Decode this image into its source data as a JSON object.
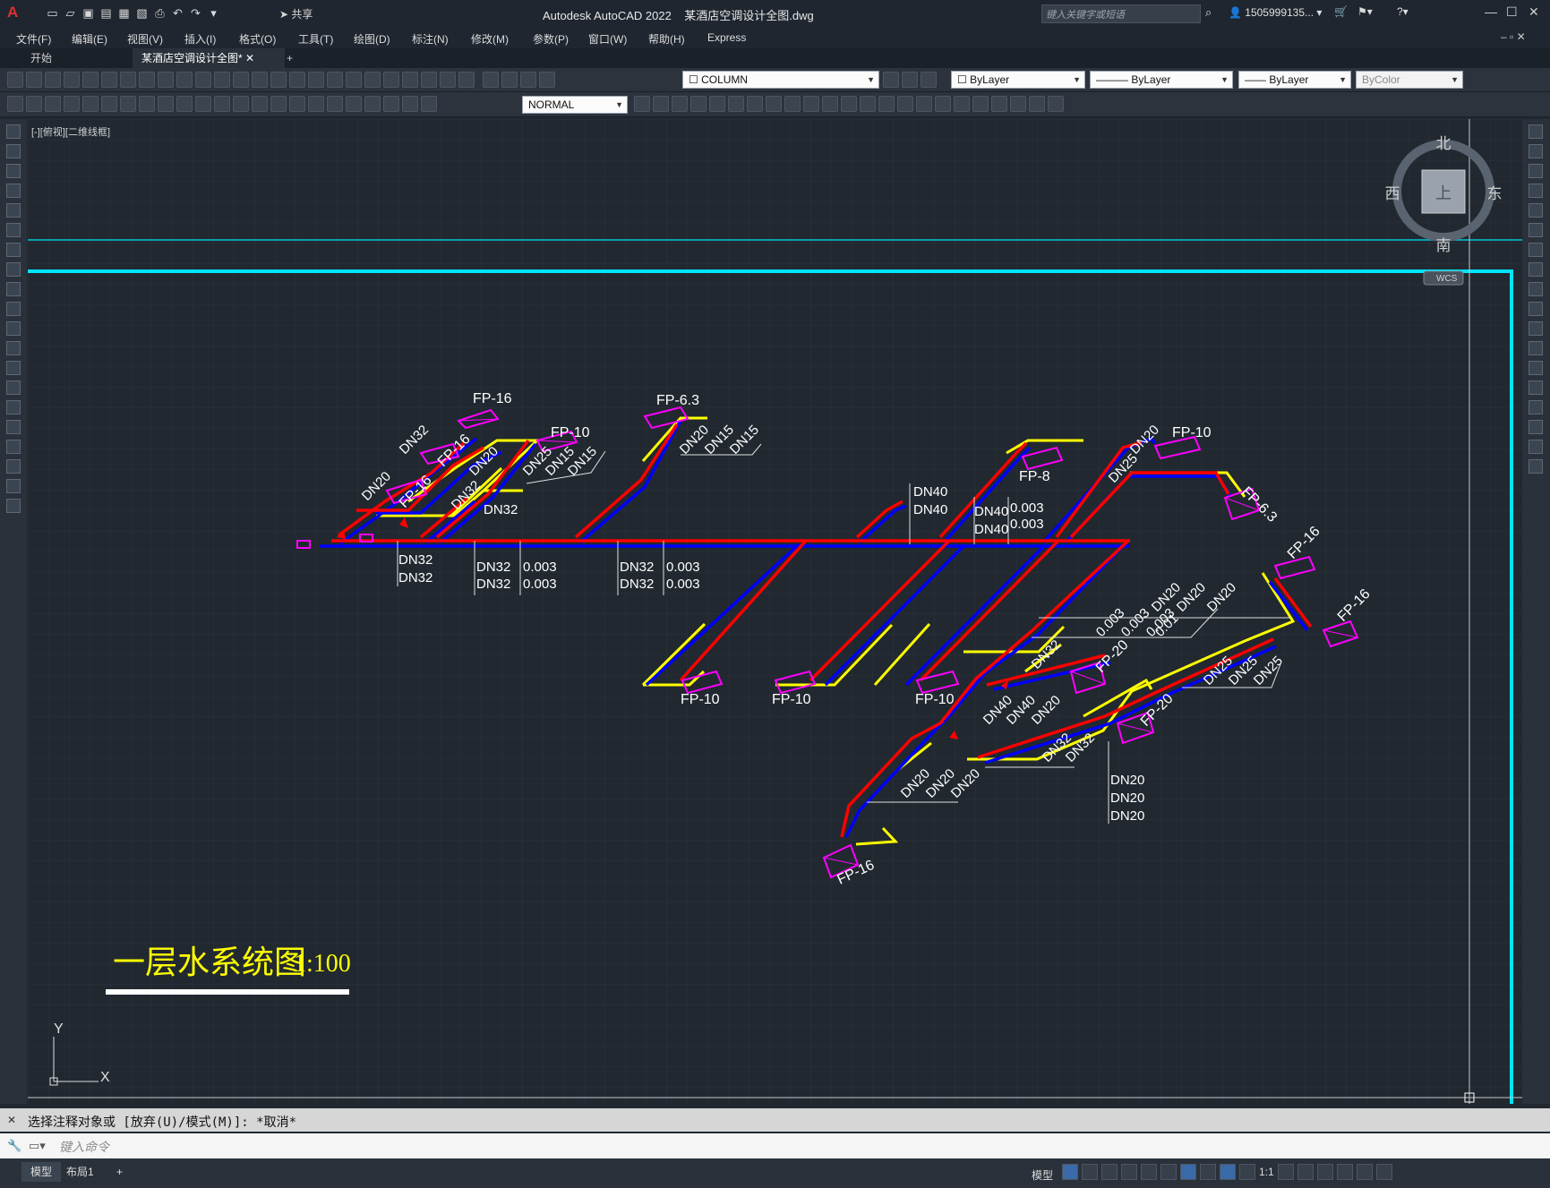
{
  "app": {
    "logo": "A",
    "title": "Autodesk AutoCAD 2022",
    "document": "某酒店空调设计全图.dwg",
    "share_label": "共享",
    "search_placeholder": "键入关键字或短语",
    "user": "1505999135..."
  },
  "menu": [
    "文件(F)",
    "编辑(E)",
    "视图(V)",
    "插入(I)",
    "格式(O)",
    "工具(T)",
    "绘图(D)",
    "标注(N)",
    "修改(M)",
    "参数(P)",
    "窗口(W)",
    "帮助(H)",
    "Express"
  ],
  "tabs": {
    "start": "开始",
    "active": "某酒店空调设计全图*",
    "close": "✕",
    "new": "+"
  },
  "toolbar": {
    "layer": "COLUMN",
    "color": "ByLayer",
    "linetype": "ByLayer",
    "lineweight": "ByLayer",
    "plotstyle": "ByColor",
    "dimstyle": "NORMAL"
  },
  "viewport": {
    "label": "[-][俯视][二维线框]"
  },
  "viewcube": {
    "north": "北",
    "south": "南",
    "east": "东",
    "west": "西",
    "top": "上",
    "wcs": "WCS"
  },
  "drawing": {
    "title": "一层水系统图",
    "scale": "1:100",
    "units": [
      "FP-16",
      "FP-10",
      "FP-6.3",
      "FP-16",
      "FP-16",
      "FP-8",
      "FP-10",
      "FP-6.3",
      "FP-16",
      "FP-16",
      "FP-20",
      "FP-20",
      "FP-10",
      "FP-10",
      "FP-10",
      "FP-16"
    ],
    "pipe_labels": [
      "DN32",
      "DN20",
      "DN32",
      "DN20",
      "DN25",
      "DN15",
      "DN15",
      "DN32",
      "DN20",
      "DN15",
      "DN15",
      "DN32",
      "DN32",
      "DN32",
      "DN32",
      "DN32",
      "DN32",
      "DN40",
      "DN40",
      "DN40",
      "DN40",
      "DN25",
      "DN20",
      "DN32",
      "DN40",
      "DN40",
      "DN20",
      "DN32",
      "DN32",
      "DN20",
      "DN20",
      "DN20",
      "DN20",
      "DN20",
      "DN20",
      "DN20",
      "DN20",
      "DN20",
      "DN25",
      "DN25",
      "DN25"
    ],
    "slopes": [
      "0.003",
      "0.003",
      "0.003",
      "0.003",
      "0.003",
      "0.003",
      "0.003",
      "0.003",
      "0.003",
      "0.01"
    ]
  },
  "ucs": {
    "x": "X",
    "y": "Y"
  },
  "command": {
    "history": "选择注释对象或 [放弃(U)/模式(M)]: *取消*",
    "placeholder": "键入命令"
  },
  "status": {
    "model_tab": "模型",
    "layout_tab": "布局1",
    "add": "+",
    "space": "模型",
    "scale": "1:1"
  },
  "colors": {
    "supply": "#ff0000",
    "return": "#0000ff",
    "condensate": "#ffff00",
    "unit": "#ff00ff",
    "frame": "#00e5ff"
  }
}
